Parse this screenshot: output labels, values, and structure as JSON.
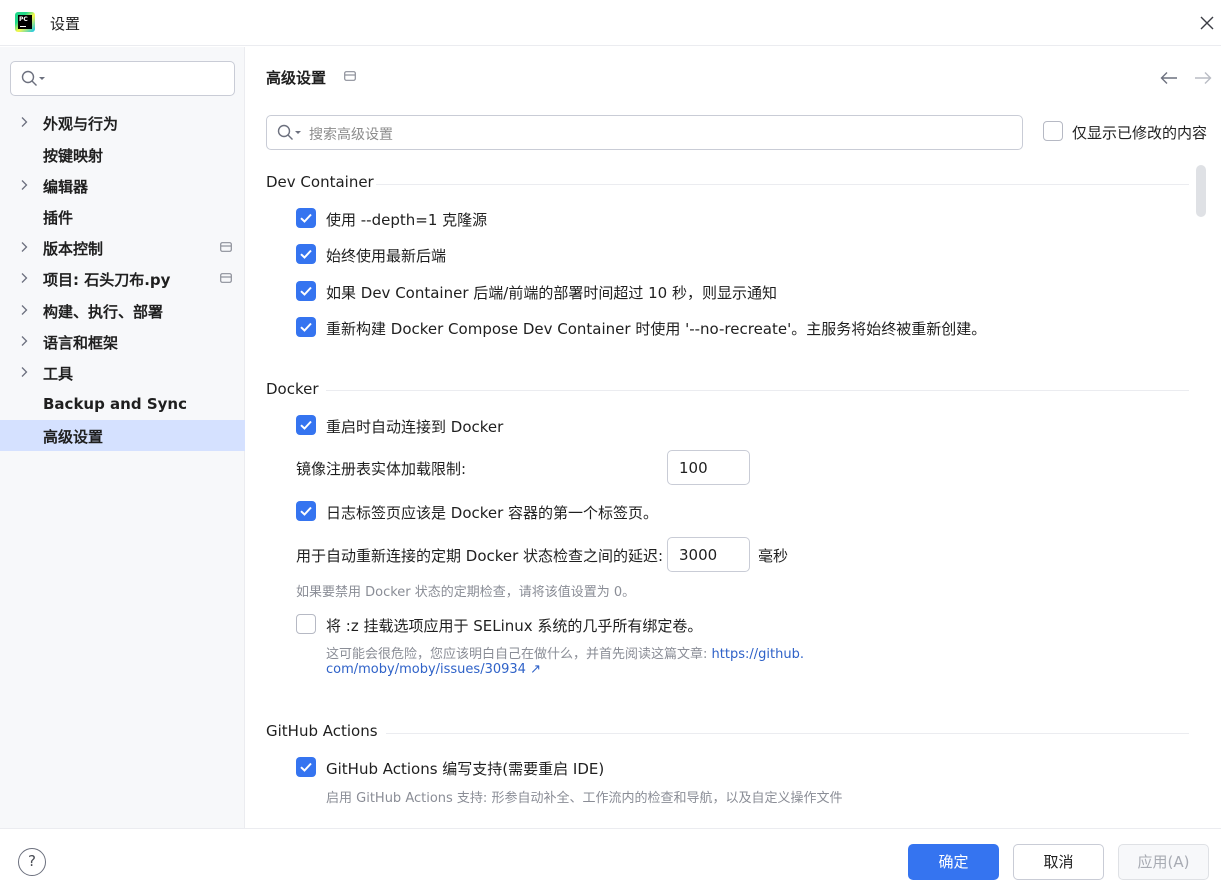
{
  "window": {
    "title": "设置",
    "logo_text": "PC"
  },
  "sidebar": {
    "search_placeholder": "",
    "items": [
      {
        "label": "外观与行为",
        "expandable": true,
        "badge": false,
        "selected": false
      },
      {
        "label": "按键映射",
        "expandable": false,
        "badge": false,
        "selected": false
      },
      {
        "label": "编辑器",
        "expandable": true,
        "badge": false,
        "selected": false
      },
      {
        "label": "插件",
        "expandable": false,
        "badge": false,
        "selected": false
      },
      {
        "label": "版本控制",
        "expandable": true,
        "badge": true,
        "selected": false
      },
      {
        "label": "项目: 石头刀布.py",
        "expandable": true,
        "badge": true,
        "selected": false
      },
      {
        "label": "构建、执行、部署",
        "expandable": true,
        "badge": false,
        "selected": false
      },
      {
        "label": "语言和框架",
        "expandable": true,
        "badge": false,
        "selected": false
      },
      {
        "label": "工具",
        "expandable": true,
        "badge": false,
        "selected": false
      },
      {
        "label": "Backup and Sync",
        "expandable": false,
        "badge": false,
        "selected": false
      },
      {
        "label": "高级设置",
        "expandable": false,
        "badge": false,
        "selected": true
      }
    ]
  },
  "main": {
    "title": "高级设置",
    "search_placeholder": "搜索高级设置",
    "show_modified_only": {
      "label": "仅显示已修改的内容",
      "checked": false
    },
    "sections": {
      "dev_container": {
        "title": "Dev Container",
        "options": [
          {
            "label": "使用 --depth=1 克隆源",
            "checked": true
          },
          {
            "label": "始终使用最新后端",
            "checked": true
          },
          {
            "label": "如果 Dev Container 后端/前端的部署时间超过 10 秒，则显示通知",
            "checked": true
          },
          {
            "label": "重新构建 Docker Compose Dev Container 时使用 '--no-recreate'。主服务将始终被重新创建。",
            "checked": true
          }
        ]
      },
      "docker": {
        "title": "Docker",
        "auto_reconnect": {
          "label": "重启时自动连接到 Docker",
          "checked": true
        },
        "registry_limit": {
          "label": "镜像注册表实体加载限制:",
          "value": "100"
        },
        "log_tab_first": {
          "label": "日志标签页应该是 Docker 容器的第一个标签页。",
          "checked": true
        },
        "status_delay": {
          "label": "用于自动重新连接的定期 Docker 状态检查之间的延迟:",
          "value": "3000",
          "unit": "毫秒",
          "hint": "如果要禁用 Docker 状态的定期检查，请将该值设置为 0。"
        },
        "selinux": {
          "label": "将 :z 挂载选项应用于 SELinux 系统的几乎所有绑定卷。",
          "checked": false,
          "hint_text": "这可能会很危险，您应该明白自己在做什么，并首先阅读这篇文章:",
          "link_line1": "https://github.",
          "link_line2": "com/moby/moby/issues/30934",
          "link_arrow": "↗"
        }
      },
      "github_actions": {
        "title": "GitHub Actions",
        "authoring": {
          "label": "GitHub Actions 编写支持(需要重启 IDE)",
          "checked": true
        },
        "hint": "启用 GitHub Actions 支持: 形参自动补全、工作流内的检查和导航，以及自定义操作文件"
      }
    }
  },
  "footer": {
    "help_label": "?",
    "ok_label": "确定",
    "cancel_label": "取消",
    "apply_label": "应用(A)"
  },
  "colors": {
    "accent": "#3574f0",
    "selection": "#d5e1ff",
    "sidebar_bg": "#f7f8fa",
    "hint_text": "#8a8d96",
    "link": "#2f62c8"
  },
  "icons": {
    "search": "search-icon",
    "chevron": "chevron-right-icon",
    "close": "close-icon",
    "back": "arrow-left-icon",
    "forward": "arrow-right-icon",
    "project_badge": "project-level-icon"
  }
}
